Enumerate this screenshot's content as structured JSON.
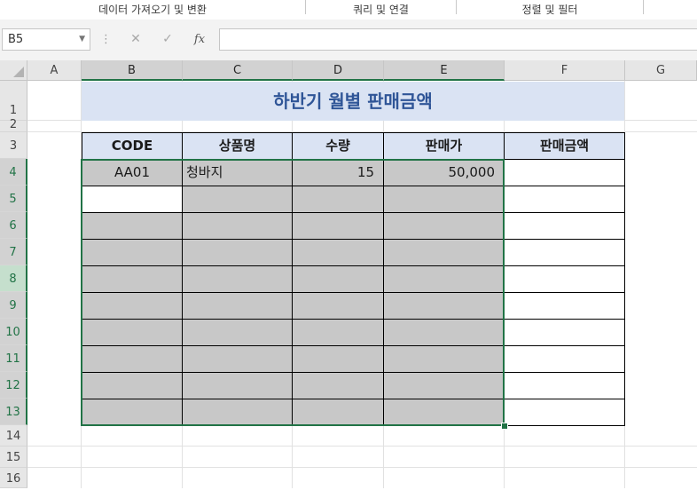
{
  "ribbon": {
    "groups": [
      "데이터 가져오기 및 변환",
      "쿼리 및 연결",
      "정렬 및 필터"
    ]
  },
  "formula_bar": {
    "name_box": "B5",
    "fx_label": "fx",
    "cancel_icon": "close-icon",
    "enter_icon": "checkmark-icon",
    "formula": ""
  },
  "sheet": {
    "columns": [
      "A",
      "B",
      "C",
      "D",
      "E",
      "F",
      "G"
    ],
    "selected_columns": [
      "B",
      "C",
      "D",
      "E"
    ],
    "rows": [
      "1",
      "2",
      "3",
      "4",
      "5",
      "6",
      "7",
      "8",
      "9",
      "10",
      "11",
      "12",
      "13",
      "14",
      "15",
      "16"
    ],
    "active_cell": "B5",
    "selection_range": "B4:E13",
    "title": "하반기 월별 판매금액",
    "headers": [
      "CODE",
      "상품명",
      "수량",
      "판매가",
      "판매금액"
    ],
    "rows_data": [
      [
        "AA01",
        "청바지",
        "15",
        "50,000",
        ""
      ],
      [
        "",
        "",
        "",
        "",
        ""
      ],
      [
        "",
        "",
        "",
        "",
        ""
      ],
      [
        "",
        "",
        "",
        "",
        ""
      ],
      [
        "",
        "",
        "",
        "",
        ""
      ],
      [
        "",
        "",
        "",
        "",
        ""
      ],
      [
        "",
        "",
        "",
        "",
        ""
      ],
      [
        "",
        "",
        "",
        "",
        ""
      ],
      [
        "",
        "",
        "",
        "",
        ""
      ],
      [
        "",
        "",
        "",
        "",
        ""
      ]
    ]
  },
  "colors": {
    "accent_green": "#217346",
    "header_fill": "#dae3f3",
    "title_text": "#2f5597",
    "selection_fill": "#c8c8c8"
  }
}
